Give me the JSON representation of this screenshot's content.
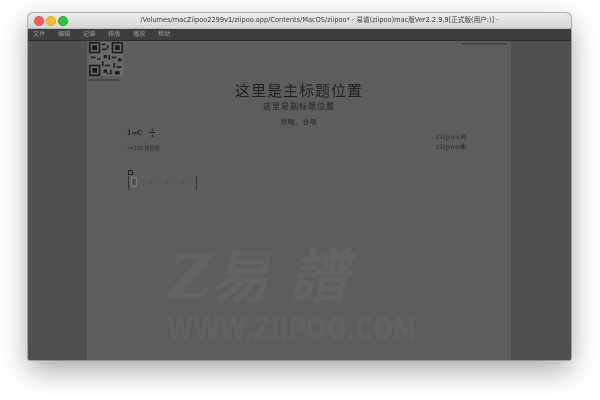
{
  "window": {
    "title": "/Volumes/macZiipoo2299v1/ziipoo.app/Contents/MacOS/ziipoo* - 易谱(ziipoo)mac版Ver2.2.9.9[正式版(用户:)] -"
  },
  "menu": {
    "items": [
      {
        "label": "文件"
      },
      {
        "label": "编辑"
      },
      {
        "label": "记谱"
      },
      {
        "label": "排版"
      },
      {
        "label": "播放"
      },
      {
        "label": "帮助"
      }
    ]
  },
  "score": {
    "main_title": "这里是主标题位置",
    "sub_title": "这里是副标题位置",
    "performance": "领唱、合唱",
    "key": "1=C",
    "time_signature": {
      "top": "4",
      "bottom": "4"
    },
    "tempo": "♩=120 热烈地",
    "composer_lines": [
      "ziipoo词",
      "ziipoo曲"
    ],
    "measure_notes": [
      "0",
      "0",
      "0",
      "0"
    ],
    "watermark_logo_text": "Z易 譜",
    "watermark_url": "WWW.ZIIPOO.COM"
  },
  "colors": {
    "paper": "#5d5d5d",
    "workspace": "#505050",
    "menubar": "#3d3d3d"
  }
}
